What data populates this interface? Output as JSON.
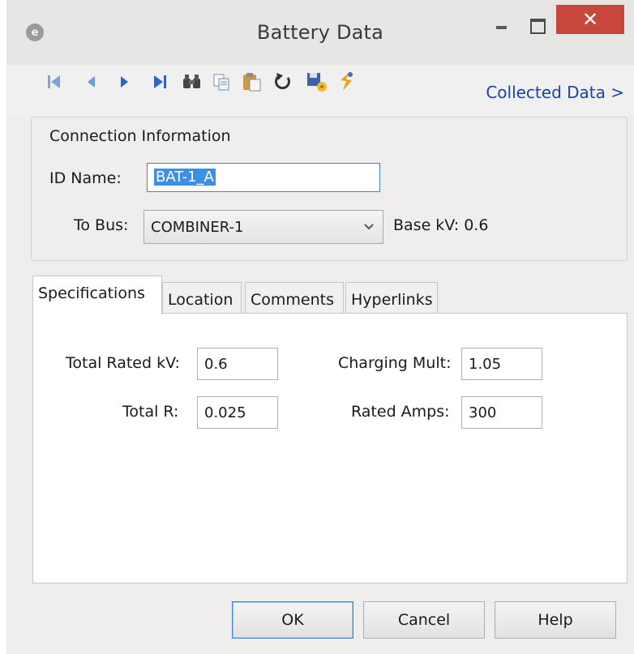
{
  "window": {
    "title": "Battery Data",
    "app_icon_glyph": "e",
    "close_glyph": "✕"
  },
  "toolbar": {
    "icons": [
      "first-record-icon",
      "previous-record-icon",
      "next-record-icon",
      "last-record-icon",
      "find-icon",
      "copy-icon",
      "paste-icon",
      "undo-icon",
      "save-icon",
      "collect-icon"
    ],
    "collected_link": "Collected Data >"
  },
  "connection": {
    "legend": "Connection Information",
    "id_label": "ID Name:",
    "id_value": "BAT-1_A",
    "bus_label": "To Bus:",
    "bus_value": "COMBINER-1",
    "base_kv": "Base kV: 0.6"
  },
  "tabs": [
    {
      "label": "Specifications",
      "active": true
    },
    {
      "label": "Location",
      "active": false
    },
    {
      "label": "Comments",
      "active": false
    },
    {
      "label": "Hyperlinks",
      "active": false
    }
  ],
  "specs": {
    "total_rated_kv_label": "Total Rated kV:",
    "total_rated_kv": "0.6",
    "total_r_label": "Total R:",
    "total_r": "0.025",
    "charging_mult_label": "Charging Mult:",
    "charging_mult": "1.05",
    "rated_amps_label": "Rated Amps:",
    "rated_amps": "300"
  },
  "buttons": {
    "ok": "OK",
    "cancel": "Cancel",
    "help": "Help"
  },
  "colors": {
    "accent": "#1e3fb0",
    "close": "#c9463d",
    "selection": "#3e8de6"
  }
}
